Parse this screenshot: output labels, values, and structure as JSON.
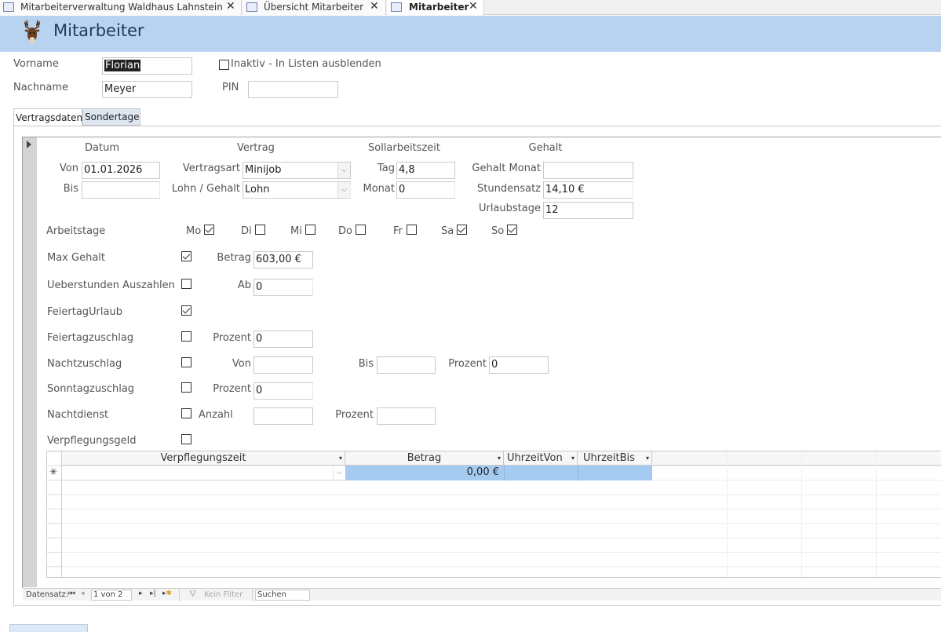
{
  "tabs": [
    {
      "label": "Mitarbeiterverwaltung Waldhaus Lahnstein",
      "active": false
    },
    {
      "label": "Übersicht Mitarbeiter",
      "active": false
    },
    {
      "label": "Mitarbeiter",
      "active": true
    }
  ],
  "form": {
    "title": "Mitarbeiter",
    "vorname_label": "Vorname",
    "vorname_value": "Florian",
    "nachname_label": "Nachname",
    "nachname_value": "Meyer",
    "inaktiv_label": "Inaktiv - In Listen ausblenden",
    "inaktiv_checked": false,
    "pin_label": "PIN",
    "pin_value": ""
  },
  "subtabs": [
    {
      "label": "Vertragsdaten",
      "active": true
    },
    {
      "label": "Sondertage",
      "active": false
    }
  ],
  "vertrag": {
    "header_datum": "Datum",
    "header_vertrag": "Vertrag",
    "header_sollarbeitszeit": "Sollarbeitszeit",
    "header_gehalt": "Gehalt",
    "von_label": "Von",
    "von_value": "01.01.2026",
    "bis_label": "Bis",
    "bis_value": "",
    "vertragsart_label": "Vertragsart",
    "vertragsart_value": "Minijob",
    "lohn_label": "Lohn / Gehalt",
    "lohn_value": "Lohn",
    "tag_label": "Tag",
    "tag_value": "4,8",
    "monat_label": "Monat",
    "monat_value": "0",
    "gehalt_monat_label": "Gehalt Monat",
    "gehalt_monat_value": "",
    "stundensatz_label": "Stundensatz",
    "stundensatz_value": "14,10 €",
    "urlaubstage_label": "Urlaubstage",
    "urlaubstage_value": "12",
    "arbeitstage_label": "Arbeitstage",
    "days": [
      {
        "label": "Mo",
        "checked": true
      },
      {
        "label": "Di",
        "checked": false
      },
      {
        "label": "Mi",
        "checked": false
      },
      {
        "label": "Do",
        "checked": false
      },
      {
        "label": "Fr",
        "checked": false
      },
      {
        "label": "Sa",
        "checked": true
      },
      {
        "label": "So",
        "checked": true
      }
    ],
    "max_gehalt_label": "Max Gehalt",
    "max_gehalt_checked": true,
    "betrag_label": "Betrag",
    "betrag_value": "603,00 €",
    "ueberstunden_label": "Ueberstunden Auszahlen",
    "ueberstunden_checked": false,
    "ab_label": "Ab",
    "ab_value": "0",
    "feiertagurlaub_label": "FeiertagUrlaub",
    "feiertagurlaub_checked": true,
    "feiertagzuschlag_label": "Feiertagzuschlag",
    "feiertagzuschlag_checked": false,
    "feiertag_prozent_label": "Prozent",
    "feiertag_prozent_value": "0",
    "nachtzuschlag_label": "Nachtzuschlag",
    "nachtzuschlag_checked": false,
    "nacht_von_label": "Von",
    "nacht_von_value": "",
    "nacht_bis_label": "Bis",
    "nacht_bis_value": "",
    "nacht_prozent_label": "Prozent",
    "nacht_prozent_value": "0",
    "sonntagzuschlag_label": "Sonntagzuschlag",
    "sonntagzuschlag_checked": false,
    "sonntag_prozent_label": "Prozent",
    "sonntag_prozent_value": "0",
    "nachtdienst_label": "Nachtdienst",
    "nachtdienst_checked": false,
    "anzahl_label": "Anzahl",
    "anzahl_value": "",
    "nachtdienst_prozent_label": "Prozent",
    "nachtdienst_prozent_value": "",
    "verpflegungsgeld_label": "Verpflegungsgeld",
    "verpflegungsgeld_checked": false
  },
  "grid": {
    "columns": [
      "Verpflegungszeit",
      "Betrag",
      "UhrzeitVon",
      "UhrzeitBis"
    ],
    "new_row_marker": "✳",
    "new_row_betrag": "0,00 €"
  },
  "navigation": {
    "label": "Datensatz:",
    "position": "1 von 2",
    "filter_label": "Kein Filter",
    "search_placeholder": "Suchen"
  },
  "colors": {
    "header_band": "#b8d3ef",
    "selection": "#a6cbf0"
  }
}
